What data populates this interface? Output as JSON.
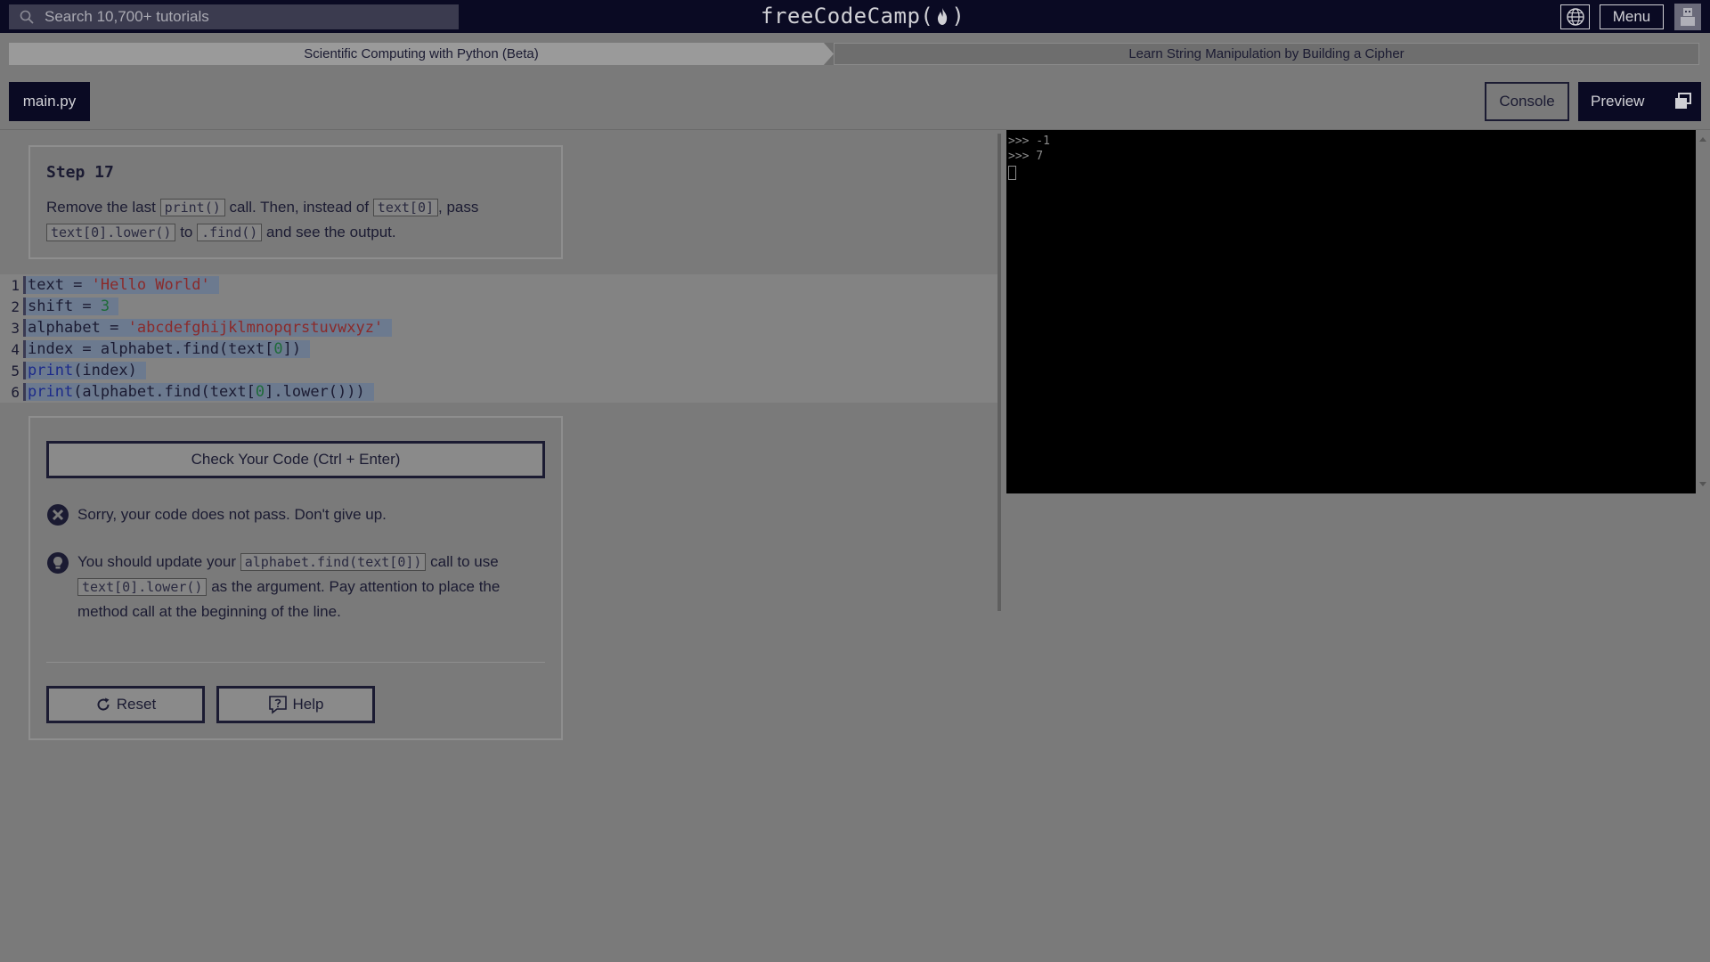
{
  "search": {
    "placeholder": "Search 10,700+ tutorials"
  },
  "brand": {
    "text_left": "freeCodeCamp(",
    "text_right": ")"
  },
  "nav": {
    "menu_label": "Menu"
  },
  "breadcrumb": {
    "superblock": "Scientific Computing with Python (Beta)",
    "block": "Learn String Manipulation by Building a Cipher"
  },
  "tabs": {
    "file": "main.py",
    "console": "Console",
    "preview": "Preview"
  },
  "step": {
    "title": "Step 17",
    "t1": "Remove the last ",
    "c1": "print()",
    "t2": " call. Then, instead of ",
    "c2": "text[0]",
    "t3": ", pass ",
    "c3": "text[0].lower()",
    "t4": " to ",
    "c4": ".find()",
    "t5": " and see the output."
  },
  "editor": {
    "lines": [
      {
        "n": "1",
        "a": "text = ",
        "s": "'Hello World'"
      },
      {
        "n": "2",
        "a": "shift = ",
        "num": "3"
      },
      {
        "n": "3",
        "a": "alphabet = ",
        "s": "'abcdefghijklmnopqrstuvwxyz'"
      },
      {
        "n": "4",
        "a": "index = alphabet.find(text[",
        "num": "0",
        "b": "])"
      },
      {
        "n": "5",
        "kw": "print",
        "a": "(index)"
      },
      {
        "n": "6",
        "kw": "print",
        "a": "(alphabet.find(text[",
        "num": "0",
        "b": "].lower()))"
      }
    ]
  },
  "actions": {
    "check": "Check Your Code (Ctrl + Enter)",
    "fail": "Sorry, your code does not pass. Don't give up.",
    "hint_t1": "You should update your ",
    "hint_c1": "alphabet.find(text[0])",
    "hint_t2": " call to use ",
    "hint_c2": "text[0].lower()",
    "hint_t3": " as the argument. Pay attention to place the method call at the beginning of the line.",
    "reset": "Reset",
    "help": "Help"
  },
  "console": {
    "line1": ">>> -1",
    "line2": ">>> 7"
  }
}
